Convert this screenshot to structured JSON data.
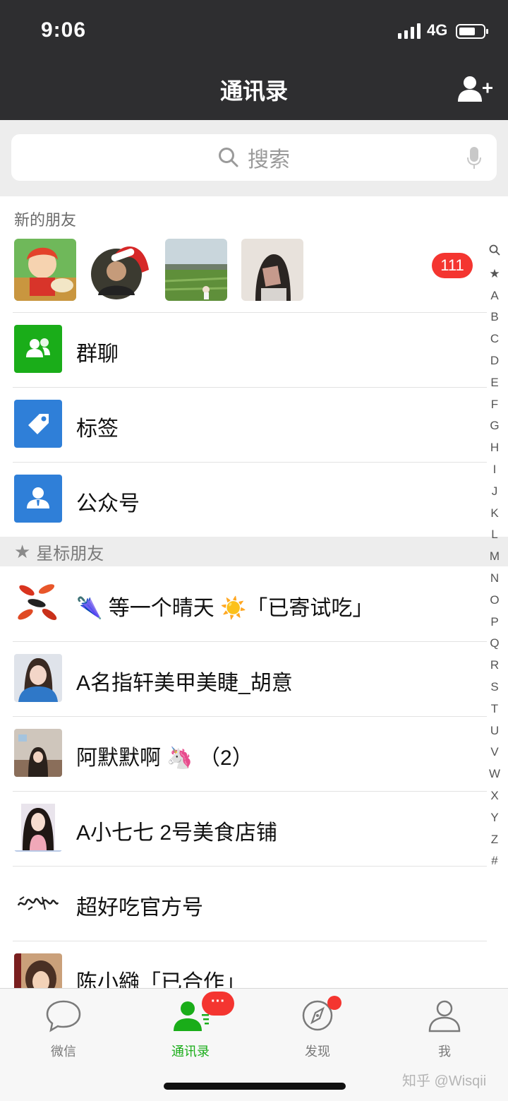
{
  "status_bar": {
    "time": "9:06",
    "network": "4G",
    "signal_bars": 4,
    "battery_level": 0.6
  },
  "nav": {
    "title": "通讯录",
    "add_icon": "add-friend-icon"
  },
  "search": {
    "placeholder": "搜索",
    "icon": "search-icon",
    "voice_icon": "microphone-icon"
  },
  "new_friends": {
    "title": "新的朋友",
    "badge": "111",
    "avatars": [
      "avatar-cartoon-girl",
      "avatar-man-santa-hat",
      "avatar-field-landscape",
      "avatar-girl-with-card"
    ]
  },
  "features": [
    {
      "label": "群聊",
      "icon": "group-chat-icon",
      "color": "#1aad19"
    },
    {
      "label": "标签",
      "icon": "tag-icon",
      "color": "#2f7fd8"
    },
    {
      "label": "公众号",
      "icon": "official-account-icon",
      "color": "#2f7fd8"
    }
  ],
  "starred": {
    "header": "星标朋友",
    "contacts": [
      {
        "name": "等一个晴天 ☀️「已寄试吃」",
        "prefix_emoji": "🌂",
        "avatar": "avatar-koi-fish"
      },
      {
        "name": "A名指轩美甲美睫_胡意",
        "avatar": "avatar-girl-blue-sweater"
      },
      {
        "name": "阿默默啊 🦄 （2）",
        "avatar": "avatar-girl-room"
      },
      {
        "name": "A小七七 2号美食店铺",
        "avatar": "avatar-girl-pink"
      },
      {
        "name": "超好吃官方号",
        "avatar": "avatar-calligraphy-logo"
      },
      {
        "name": "陈小繈「已合作」",
        "avatar": "avatar-girl-warm"
      }
    ]
  },
  "index": [
    "🔍",
    "★",
    "A",
    "B",
    "C",
    "D",
    "E",
    "F",
    "G",
    "H",
    "I",
    "J",
    "K",
    "L",
    "M",
    "N",
    "O",
    "P",
    "Q",
    "R",
    "S",
    "T",
    "U",
    "V",
    "W",
    "X",
    "Y",
    "Z",
    "#"
  ],
  "tabs": [
    {
      "label": "微信",
      "icon": "chat-bubble-icon"
    },
    {
      "label": "通讯录",
      "icon": "contacts-icon",
      "active": true,
      "badge": "···"
    },
    {
      "label": "发现",
      "icon": "compass-icon",
      "dot": true
    },
    {
      "label": "我",
      "icon": "person-icon"
    }
  ],
  "watermark": "知乎 @Wisqii",
  "colors": {
    "nav_bg": "#2e2e30",
    "accent_green": "#1aad19",
    "badge_red": "#f43530"
  }
}
